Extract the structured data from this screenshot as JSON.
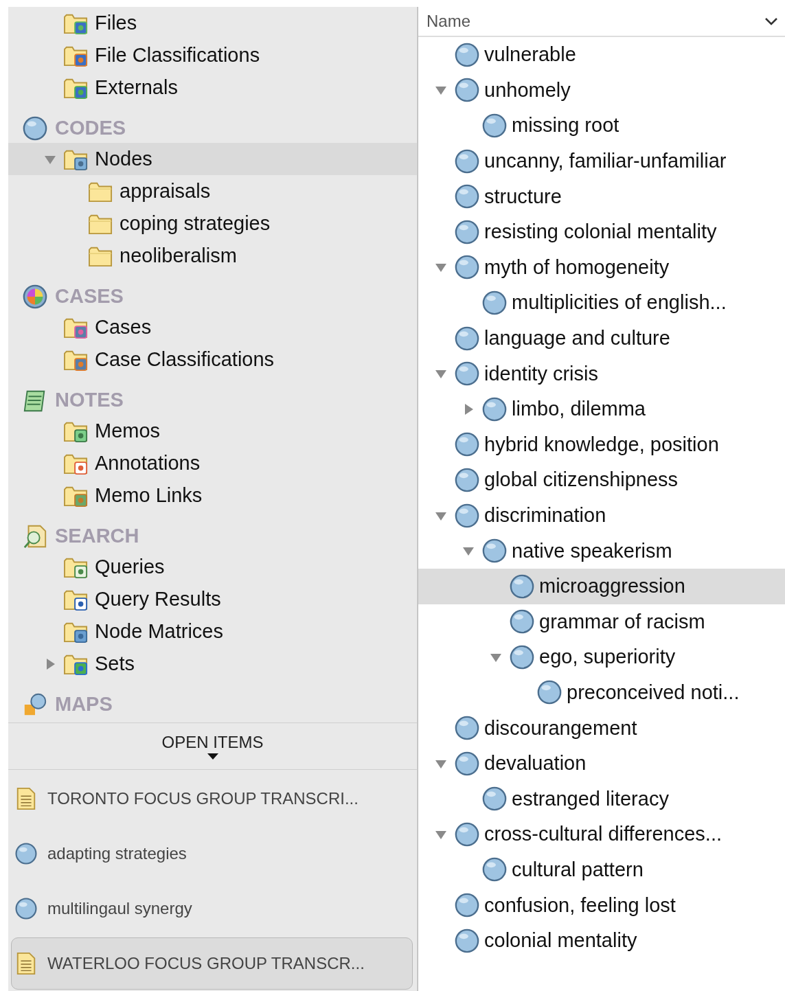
{
  "navigation": {
    "sections": [
      {
        "items": [
          {
            "label": "Files",
            "kind": "files",
            "selected": false
          },
          {
            "label": "File Classifications",
            "kind": "classifications",
            "selected": false
          },
          {
            "label": "Externals",
            "kind": "externals",
            "selected": false
          }
        ]
      },
      {
        "title": "CODES",
        "kind": "codes",
        "items": [
          {
            "label": "Nodes",
            "kind": "nodes",
            "selected": true,
            "expanded": true,
            "children": [
              {
                "label": "appraisals",
                "kind": "folder",
                "selected": false
              },
              {
                "label": "coping strategies",
                "kind": "folder",
                "selected": false
              },
              {
                "label": "neoliberalism",
                "kind": "folder",
                "selected": false
              }
            ]
          }
        ]
      },
      {
        "title": "CASES",
        "kind": "cases",
        "items": [
          {
            "label": "Cases",
            "kind": "cases",
            "selected": false
          },
          {
            "label": "Case Classifications",
            "kind": "case-classifications",
            "selected": false
          }
        ]
      },
      {
        "title": "NOTES",
        "kind": "notes",
        "items": [
          {
            "label": "Memos",
            "kind": "memos",
            "selected": false
          },
          {
            "label": "Annotations",
            "kind": "annotations",
            "selected": false
          },
          {
            "label": "Memo Links",
            "kind": "memo-links",
            "selected": false
          }
        ]
      },
      {
        "title": "SEARCH",
        "kind": "search",
        "items": [
          {
            "label": "Queries",
            "kind": "queries",
            "selected": false
          },
          {
            "label": "Query Results",
            "kind": "query-results",
            "selected": false
          },
          {
            "label": "Node Matrices",
            "kind": "matrices",
            "selected": false
          },
          {
            "label": "Sets",
            "kind": "sets",
            "selected": false,
            "expanded": false
          }
        ]
      },
      {
        "title": "MAPS",
        "kind": "maps"
      }
    ]
  },
  "open_items": {
    "title": "OPEN ITEMS",
    "items": [
      {
        "label": "TORONTO FOCUS GROUP TRANSCRI...",
        "kind": "document",
        "selected": false
      },
      {
        "label": "adapting strategies",
        "kind": "code",
        "selected": false
      },
      {
        "label": "multilingaul synergy",
        "kind": "code",
        "selected": false
      },
      {
        "label": "WATERLOO FOCUS GROUP TRANSCR...",
        "kind": "document",
        "selected": true
      }
    ]
  },
  "code_list": {
    "column": "Name",
    "nodes": [
      {
        "label": "vulnerable",
        "selected": false
      },
      {
        "label": "unhomely",
        "selected": false,
        "expanded": true,
        "children": [
          {
            "label": "missing root",
            "selected": false
          }
        ]
      },
      {
        "label": "uncanny, familiar-unfamiliar",
        "selected": false
      },
      {
        "label": "structure",
        "selected": false
      },
      {
        "label": "resisting colonial mentality",
        "selected": false
      },
      {
        "label": "myth of homogeneity",
        "selected": false,
        "expanded": true,
        "children": [
          {
            "label": "multiplicities of english...",
            "selected": false
          }
        ]
      },
      {
        "label": "language and culture",
        "selected": false
      },
      {
        "label": "identity crisis",
        "selected": false,
        "expanded": true,
        "children": [
          {
            "label": "limbo, dilemma",
            "selected": false,
            "expanded": false
          }
        ]
      },
      {
        "label": "hybrid knowledge, position",
        "selected": false
      },
      {
        "label": "global citizenshipness",
        "selected": false
      },
      {
        "label": "discrimination",
        "selected": false,
        "expanded": true,
        "children": [
          {
            "label": "native speakerism",
            "selected": false,
            "expanded": true,
            "children": [
              {
                "label": "microaggression",
                "selected": true
              },
              {
                "label": "grammar of racism",
                "selected": false
              },
              {
                "label": "ego, superiority",
                "selected": false,
                "expanded": true,
                "children": [
                  {
                    "label": "preconceived noti...",
                    "selected": false
                  }
                ]
              }
            ]
          }
        ]
      },
      {
        "label": "discourangement",
        "selected": false
      },
      {
        "label": "devaluation",
        "selected": false,
        "expanded": true,
        "children": [
          {
            "label": "estranged literacy",
            "selected": false
          }
        ]
      },
      {
        "label": "cross-cultural differences...",
        "selected": false,
        "expanded": true,
        "children": [
          {
            "label": "cultural pattern",
            "selected": false
          }
        ]
      },
      {
        "label": "confusion, feeling lost",
        "selected": false
      },
      {
        "label": "colonial mentality",
        "selected": false
      }
    ]
  }
}
